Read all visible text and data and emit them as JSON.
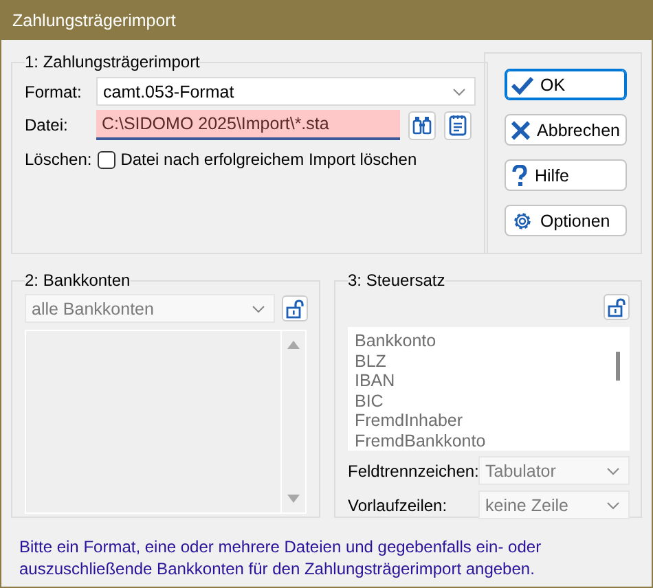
{
  "window": {
    "title": "Zahlungsträgerimport"
  },
  "import_group": {
    "legend": "1: Zahlungsträgerimport",
    "format": {
      "label": "Format:",
      "value": "camt.053-Format"
    },
    "file": {
      "label": "Datei:",
      "value": "C:\\SIDOMO 2025\\Import\\*.sta",
      "invalid": true
    },
    "delete": {
      "label": "Löschen:",
      "checkbox_label": "Datei nach erfolgreichem Import löschen",
      "checked": false
    }
  },
  "buttons": [
    {
      "kind": "ok",
      "label": "OK",
      "default": true
    },
    {
      "kind": "cancel",
      "label": "Abbrechen",
      "default": false
    },
    {
      "kind": "help",
      "label": "Hilfe",
      "default": false
    },
    {
      "kind": "options",
      "label": "Optionen",
      "default": false
    }
  ],
  "bank_accounts": {
    "legend": "2: Bankkonten",
    "filter": {
      "value": "alle Bankkonten",
      "disabled": true
    }
  },
  "tax_set": {
    "legend": "3: Steuersatz",
    "fields": [
      "Bankkonto",
      "BLZ",
      "IBAN",
      "BIC",
      "FremdInhaber",
      "FremdBankkonto"
    ],
    "separator": {
      "label": "Feldtrennzeichen:",
      "value": "Tabulator",
      "disabled": true
    },
    "header_lines": {
      "label": "Vorlaufzeilen:",
      "value": "keine Zeile",
      "disabled": true
    }
  },
  "hint": "Bitte ein Format, eine oder mehrere Dateien und gegebenfalls ein- oder auszuschließende Bankkonten für den Zahlungsträgerimport angeben."
}
